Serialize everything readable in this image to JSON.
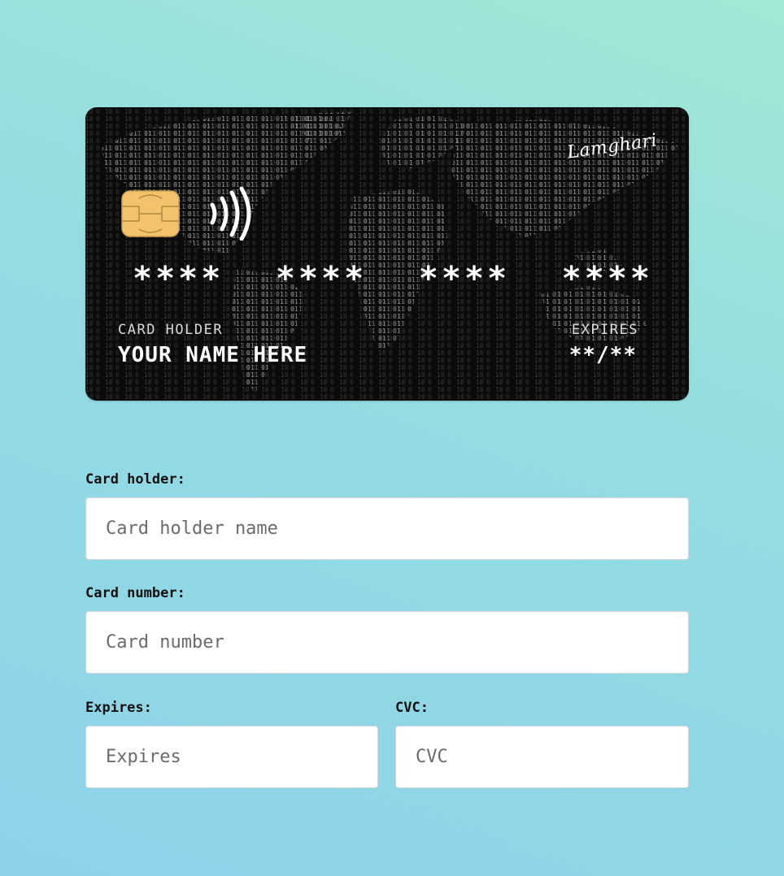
{
  "card": {
    "brand": "Lamghari",
    "number_groups": [
      "****",
      "****",
      "****",
      "****"
    ],
    "holder_label": "CARD HOLDER",
    "holder_name": "YOUR NAME HERE",
    "expires_label": "EXPIRES",
    "expires_value": "**/**",
    "background_color": "#0b0b0b",
    "chip_color": "#f2c26d"
  },
  "form": {
    "holder": {
      "label": "Card holder:",
      "placeholder": "Card holder name"
    },
    "number": {
      "label": "Card number:",
      "placeholder": "Card number"
    },
    "expires": {
      "label": "Expires:",
      "placeholder": "Expires"
    },
    "cvc": {
      "label": "CVC:",
      "placeholder": "CVC"
    }
  },
  "icons": [
    "chip-icon",
    "contactless-icon",
    "world-map-graphic"
  ]
}
